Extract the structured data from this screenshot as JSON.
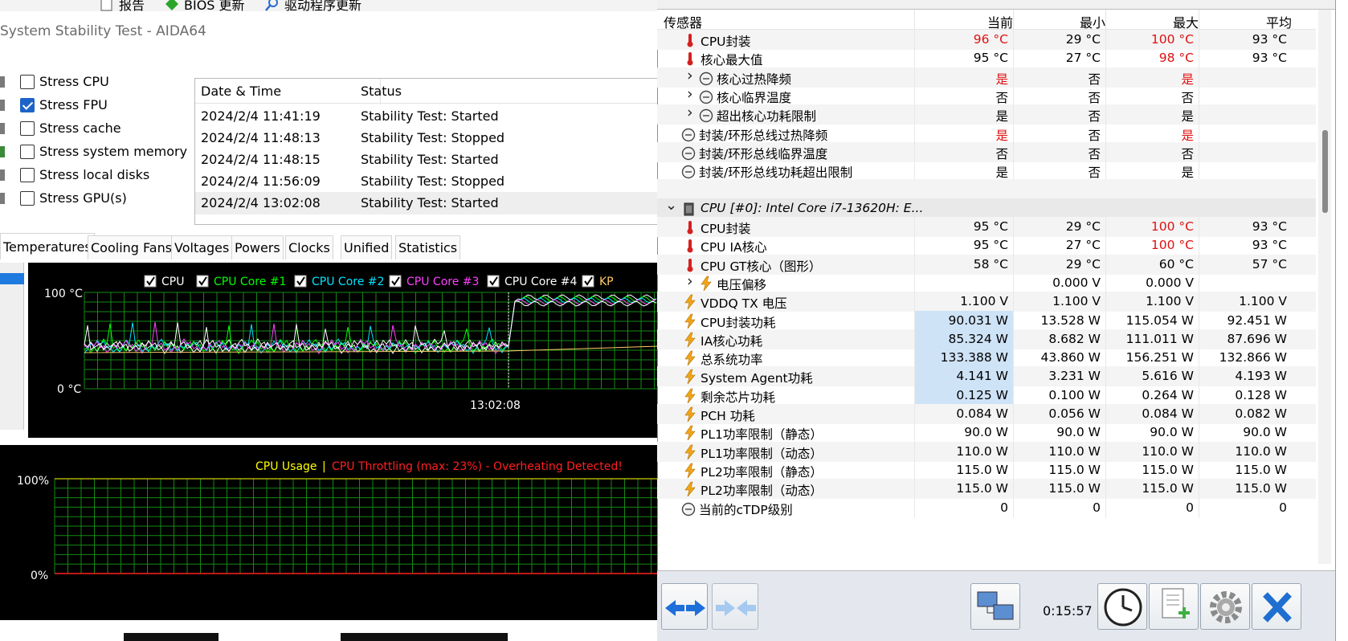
{
  "toolbar": {
    "items": [
      "报告",
      "BIOS 更新",
      "驱动程序更新"
    ]
  },
  "aida": {
    "window_title": "System Stability Test - AIDA64",
    "stress_options": [
      {
        "label": "Stress CPU",
        "checked": false,
        "icon": "cpu-icon"
      },
      {
        "label": "Stress FPU",
        "checked": true,
        "icon": "fpu-icon"
      },
      {
        "label": "Stress cache",
        "checked": false,
        "icon": "cache-icon"
      },
      {
        "label": "Stress system memory",
        "checked": false,
        "icon": "memory-icon"
      },
      {
        "label": "Stress local disks",
        "checked": false,
        "icon": "disk-icon"
      },
      {
        "label": "Stress GPU(s)",
        "checked": false,
        "icon": "gpu-icon"
      }
    ],
    "log": {
      "col_date": "Date & Time",
      "col_status": "Status",
      "rows": [
        {
          "date": "2024/2/4 11:41:19",
          "status": "Stability Test: Started"
        },
        {
          "date": "2024/2/4 11:48:13",
          "status": "Stability Test: Stopped"
        },
        {
          "date": "2024/2/4 11:48:15",
          "status": "Stability Test: Started"
        },
        {
          "date": "2024/2/4 11:56:09",
          "status": "Stability Test: Stopped"
        },
        {
          "date": "2024/2/4 13:02:08",
          "status": "Stability Test: Started"
        }
      ]
    },
    "tabs": [
      "Temperatures",
      "Cooling Fans",
      "Voltages",
      "Powers",
      "Clocks",
      "Unified",
      "Statistics"
    ],
    "active_tab": "Temperatures",
    "temp_chart": {
      "legend": [
        {
          "label": "CPU",
          "color": "#ffffff"
        },
        {
          "label": "CPU Core #1",
          "color": "#00ff00"
        },
        {
          "label": "CPU Core #2",
          "color": "#00e5ff"
        },
        {
          "label": "CPU Core #3",
          "color": "#ff40ff"
        },
        {
          "label": "CPU Core #4",
          "color": "#ffffff"
        },
        {
          "label": "KP",
          "color": "#ffcc66"
        }
      ],
      "y_max_label": "100 °C",
      "y_min_label": "0 °C",
      "marker_time": "13:02:08"
    },
    "usage_chart": {
      "label_usage": "CPU Usage",
      "separator": "|",
      "label_throttle": "CPU Throttling (max: 23%) - Overheating Detected!",
      "y_max_label": "100%",
      "y_min_label": "0%",
      "color_usage": "#ffff00",
      "color_throttle": "#ff2020"
    }
  },
  "hwinfo": {
    "columns": [
      "传感器",
      "当前",
      "最小",
      "最大",
      "平均"
    ],
    "rows": [
      {
        "name": "CPU封装",
        "icon": "thermometer-icon",
        "indent": 1,
        "cur": "96 °C",
        "min": "29 °C",
        "max": "100 °C",
        "avg": "93 °C",
        "cur_red": true,
        "max_red": true
      },
      {
        "name": "核心最大值",
        "icon": "thermometer-icon",
        "indent": 1,
        "cur": "95 °C",
        "min": "27 °C",
        "max": "98 °C",
        "avg": "93 °C",
        "max_red": true
      },
      {
        "name": "核心过热降频",
        "icon": "clock-icon",
        "indent": 1,
        "expand": true,
        "cur": "是",
        "min": "否",
        "max": "是",
        "avg": "",
        "cur_red": true,
        "max_red": true
      },
      {
        "name": "核心临界温度",
        "icon": "clock-icon",
        "indent": 1,
        "expand": true,
        "cur": "否",
        "min": "否",
        "max": "否",
        "avg": ""
      },
      {
        "name": "超出核心功耗限制",
        "icon": "clock-icon",
        "indent": 1,
        "expand": true,
        "cur": "是",
        "min": "否",
        "max": "是",
        "avg": ""
      },
      {
        "name": "封装/环形总线过热降频",
        "icon": "clock-icon",
        "indent": 0,
        "cur": "是",
        "min": "否",
        "max": "是",
        "avg": "",
        "cur_red": true,
        "max_red": true
      },
      {
        "name": "封装/环形总线临界温度",
        "icon": "clock-icon",
        "indent": 0,
        "cur": "否",
        "min": "否",
        "max": "否",
        "avg": ""
      },
      {
        "name": "封装/环形总线功耗超出限制",
        "icon": "clock-icon",
        "indent": 0,
        "cur": "是",
        "min": "否",
        "max": "是",
        "avg": ""
      },
      {
        "name": "",
        "blank": true
      },
      {
        "name": "CPU [#0]: Intel Core i7-13620H: E...",
        "icon": "chip-icon",
        "group": true
      },
      {
        "name": "CPU封装",
        "icon": "thermometer-icon",
        "indent": 1,
        "cur": "95 °C",
        "min": "29 °C",
        "max": "100 °C",
        "avg": "93 °C",
        "max_red": true
      },
      {
        "name": "CPU IA核心",
        "icon": "thermometer-icon",
        "indent": 1,
        "cur": "95 °C",
        "min": "27 °C",
        "max": "100 °C",
        "avg": "93 °C",
        "max_red": true
      },
      {
        "name": "CPU GT核心（图形）",
        "icon": "thermometer-icon",
        "indent": 1,
        "cur": "58 °C",
        "min": "29 °C",
        "max": "60 °C",
        "avg": "57 °C"
      },
      {
        "name": "电压偏移",
        "icon": "bolt-icon",
        "indent": 1,
        "expand": true,
        "cur": "",
        "min": "0.000 V",
        "max": "0.000 V",
        "avg": ""
      },
      {
        "name": "VDDQ TX 电压",
        "icon": "bolt-icon",
        "indent": 1,
        "cur": "1.100 V",
        "min": "1.100 V",
        "max": "1.100 V",
        "avg": "1.100 V"
      },
      {
        "name": "CPU封装功耗",
        "icon": "bolt-icon",
        "indent": 1,
        "cur": "90.031 W",
        "min": "13.528 W",
        "max": "115.054 W",
        "avg": "92.451 W",
        "hl": true
      },
      {
        "name": "IA核心功耗",
        "icon": "bolt-icon",
        "indent": 1,
        "cur": "85.324 W",
        "min": "8.682 W",
        "max": "111.011 W",
        "avg": "87.696 W",
        "hl": true
      },
      {
        "name": "总系统功率",
        "icon": "bolt-icon",
        "indent": 1,
        "cur": "133.388 W",
        "min": "43.860 W",
        "max": "156.251 W",
        "avg": "132.866 W",
        "hl": true
      },
      {
        "name": "System Agent功耗",
        "icon": "bolt-icon",
        "indent": 1,
        "cur": "4.141 W",
        "min": "3.231 W",
        "max": "5.616 W",
        "avg": "4.193 W",
        "hl": true
      },
      {
        "name": "剩余芯片功耗",
        "icon": "bolt-icon",
        "indent": 1,
        "cur": "0.125 W",
        "min": "0.100 W",
        "max": "0.264 W",
        "avg": "0.128 W",
        "hl": true
      },
      {
        "name": "PCH 功耗",
        "icon": "bolt-icon",
        "indent": 1,
        "cur": "0.084 W",
        "min": "0.056 W",
        "max": "0.084 W",
        "avg": "0.082 W"
      },
      {
        "name": "PL1功率限制（静态）",
        "icon": "bolt-icon",
        "indent": 1,
        "cur": "90.0 W",
        "min": "90.0 W",
        "max": "90.0 W",
        "avg": "90.0 W"
      },
      {
        "name": "PL1功率限制（动态）",
        "icon": "bolt-icon",
        "indent": 1,
        "cur": "110.0 W",
        "min": "110.0 W",
        "max": "110.0 W",
        "avg": "110.0 W"
      },
      {
        "name": "PL2功率限制（静态）",
        "icon": "bolt-icon",
        "indent": 1,
        "cur": "115.0 W",
        "min": "115.0 W",
        "max": "115.0 W",
        "avg": "115.0 W"
      },
      {
        "name": "PL2功率限制（动态）",
        "icon": "bolt-icon",
        "indent": 1,
        "cur": "115.0 W",
        "min": "115.0 W",
        "max": "115.0 W",
        "avg": "115.0 W"
      },
      {
        "name": "当前的cTDP级别",
        "icon": "clock-icon",
        "indent": 0,
        "cur": "0",
        "min": "0",
        "max": "0",
        "avg": "0"
      }
    ],
    "timer": "0:15:57",
    "colors": {
      "red": "#e01010",
      "highlight": "#cfe3f7"
    }
  }
}
